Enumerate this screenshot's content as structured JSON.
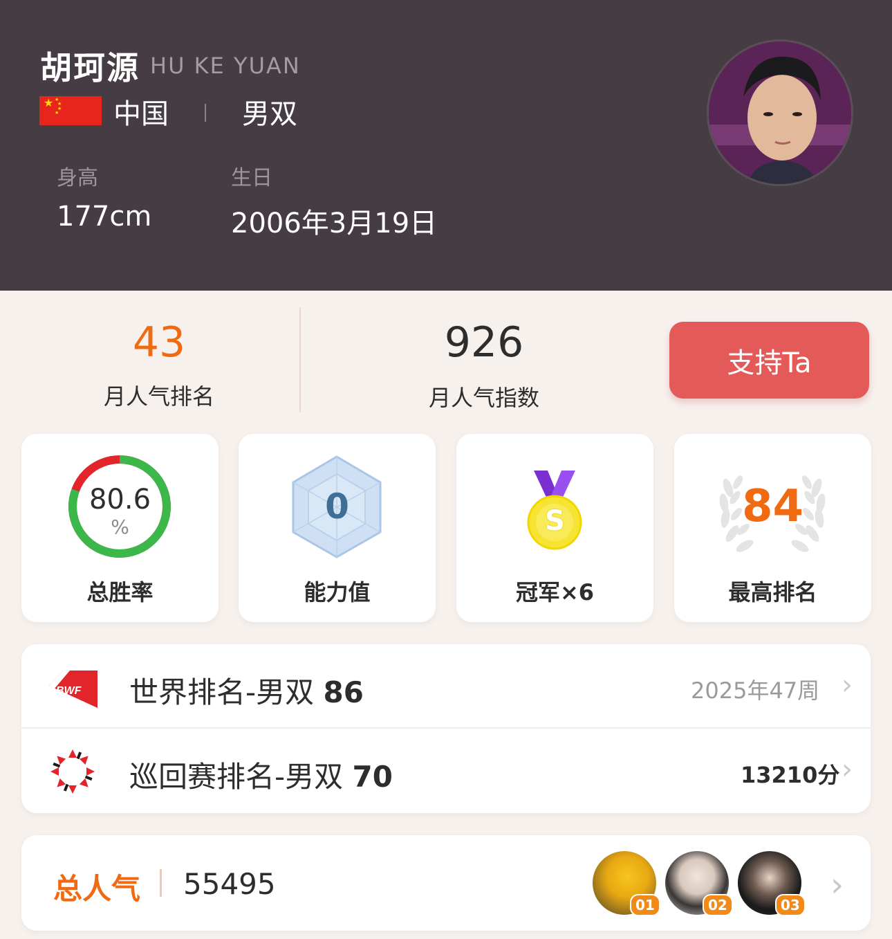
{
  "player": {
    "name_cn": "胡珂源",
    "name_en": "HU KE YUAN",
    "country": "中国",
    "event": "男双",
    "height_label": "身高",
    "height_value": "177cm",
    "birthday_label": "生日",
    "birthday_value": "2006年3月19日"
  },
  "stats": {
    "monthly_rank_value": "43",
    "monthly_rank_label": "月人气排名",
    "monthly_index_value": "926",
    "monthly_index_label": "月人气指数",
    "support_button": "支持Ta"
  },
  "cards": {
    "win_rate_value": "80.6",
    "win_rate_unit": "%",
    "win_rate_fraction": 0.806,
    "win_rate_label": "总胜率",
    "ability_value": "0",
    "ability_label": "能力值",
    "champion_label": "冠军×6",
    "medal_letter": "S",
    "best_rank_value": "84",
    "best_rank_label": "最高排名"
  },
  "rankings": [
    {
      "logo": "bwf-logo",
      "logo_text": "BWF",
      "title": "世界排名-男双",
      "rank": "86",
      "meta": "2025年47周"
    },
    {
      "logo": "tour-logo",
      "title": "巡回赛排名-男双",
      "rank": "70",
      "meta": "13210分"
    }
  ],
  "popularity": {
    "label": "总人气",
    "value": "55495",
    "fans": [
      {
        "tag": "01"
      },
      {
        "tag": "02"
      },
      {
        "tag": "03"
      }
    ]
  },
  "colors": {
    "header_bg": "#463c43",
    "accent_orange": "#f06a12",
    "button_red": "#e35a58",
    "win_green": "#3cb84a",
    "loss_red": "#e1252b"
  }
}
